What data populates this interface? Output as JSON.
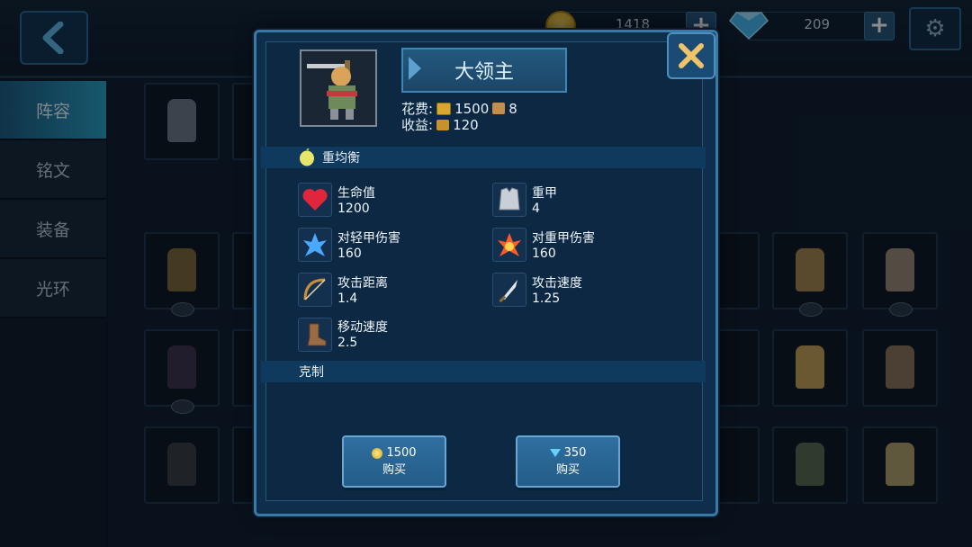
{
  "top_bar": {
    "gold_value": "1418",
    "gem_value": "209",
    "icons": [
      "back-arrow-icon",
      "gold-coin-icon",
      "plus-icon",
      "gem-icon",
      "plus-icon",
      "gear-icon"
    ]
  },
  "sidebar": {
    "items": [
      {
        "label": "阵容"
      },
      {
        "label": "铭文"
      },
      {
        "label": "装备"
      },
      {
        "label": "光环"
      }
    ]
  },
  "modal": {
    "unit_name": "大领主",
    "cost_label": "花费:",
    "cost_gold": "1500",
    "cost_population": "8",
    "income_label": "收益:",
    "income_value": "120",
    "balance_label": "重均衡",
    "counter_label": "克制",
    "stats": [
      {
        "label": "生命值",
        "value": "1200",
        "icon": "heart-icon"
      },
      {
        "label": "重甲",
        "value": "4",
        "icon": "heavy-armor-icon"
      },
      {
        "label": "对轻甲伤害",
        "value": "160",
        "icon": "light-armor-damage-icon"
      },
      {
        "label": "对重甲伤害",
        "value": "160",
        "icon": "heavy-armor-damage-icon"
      },
      {
        "label": "攻击距离",
        "value": "1.4",
        "icon": "bow-icon"
      },
      {
        "label": "攻击速度",
        "value": "1.25",
        "icon": "blade-icon"
      },
      {
        "label": "移动速度",
        "value": "2.5",
        "icon": "boot-icon"
      }
    ],
    "buy_gold": {
      "price": "1500",
      "label": "购买"
    },
    "buy_gem": {
      "price": "350",
      "label": "购买"
    }
  },
  "colors": {
    "accent": "#3a79a6",
    "modal_bg": "#0d2842",
    "active_tab": "#2aa0c7",
    "heart": "#e0263a"
  }
}
